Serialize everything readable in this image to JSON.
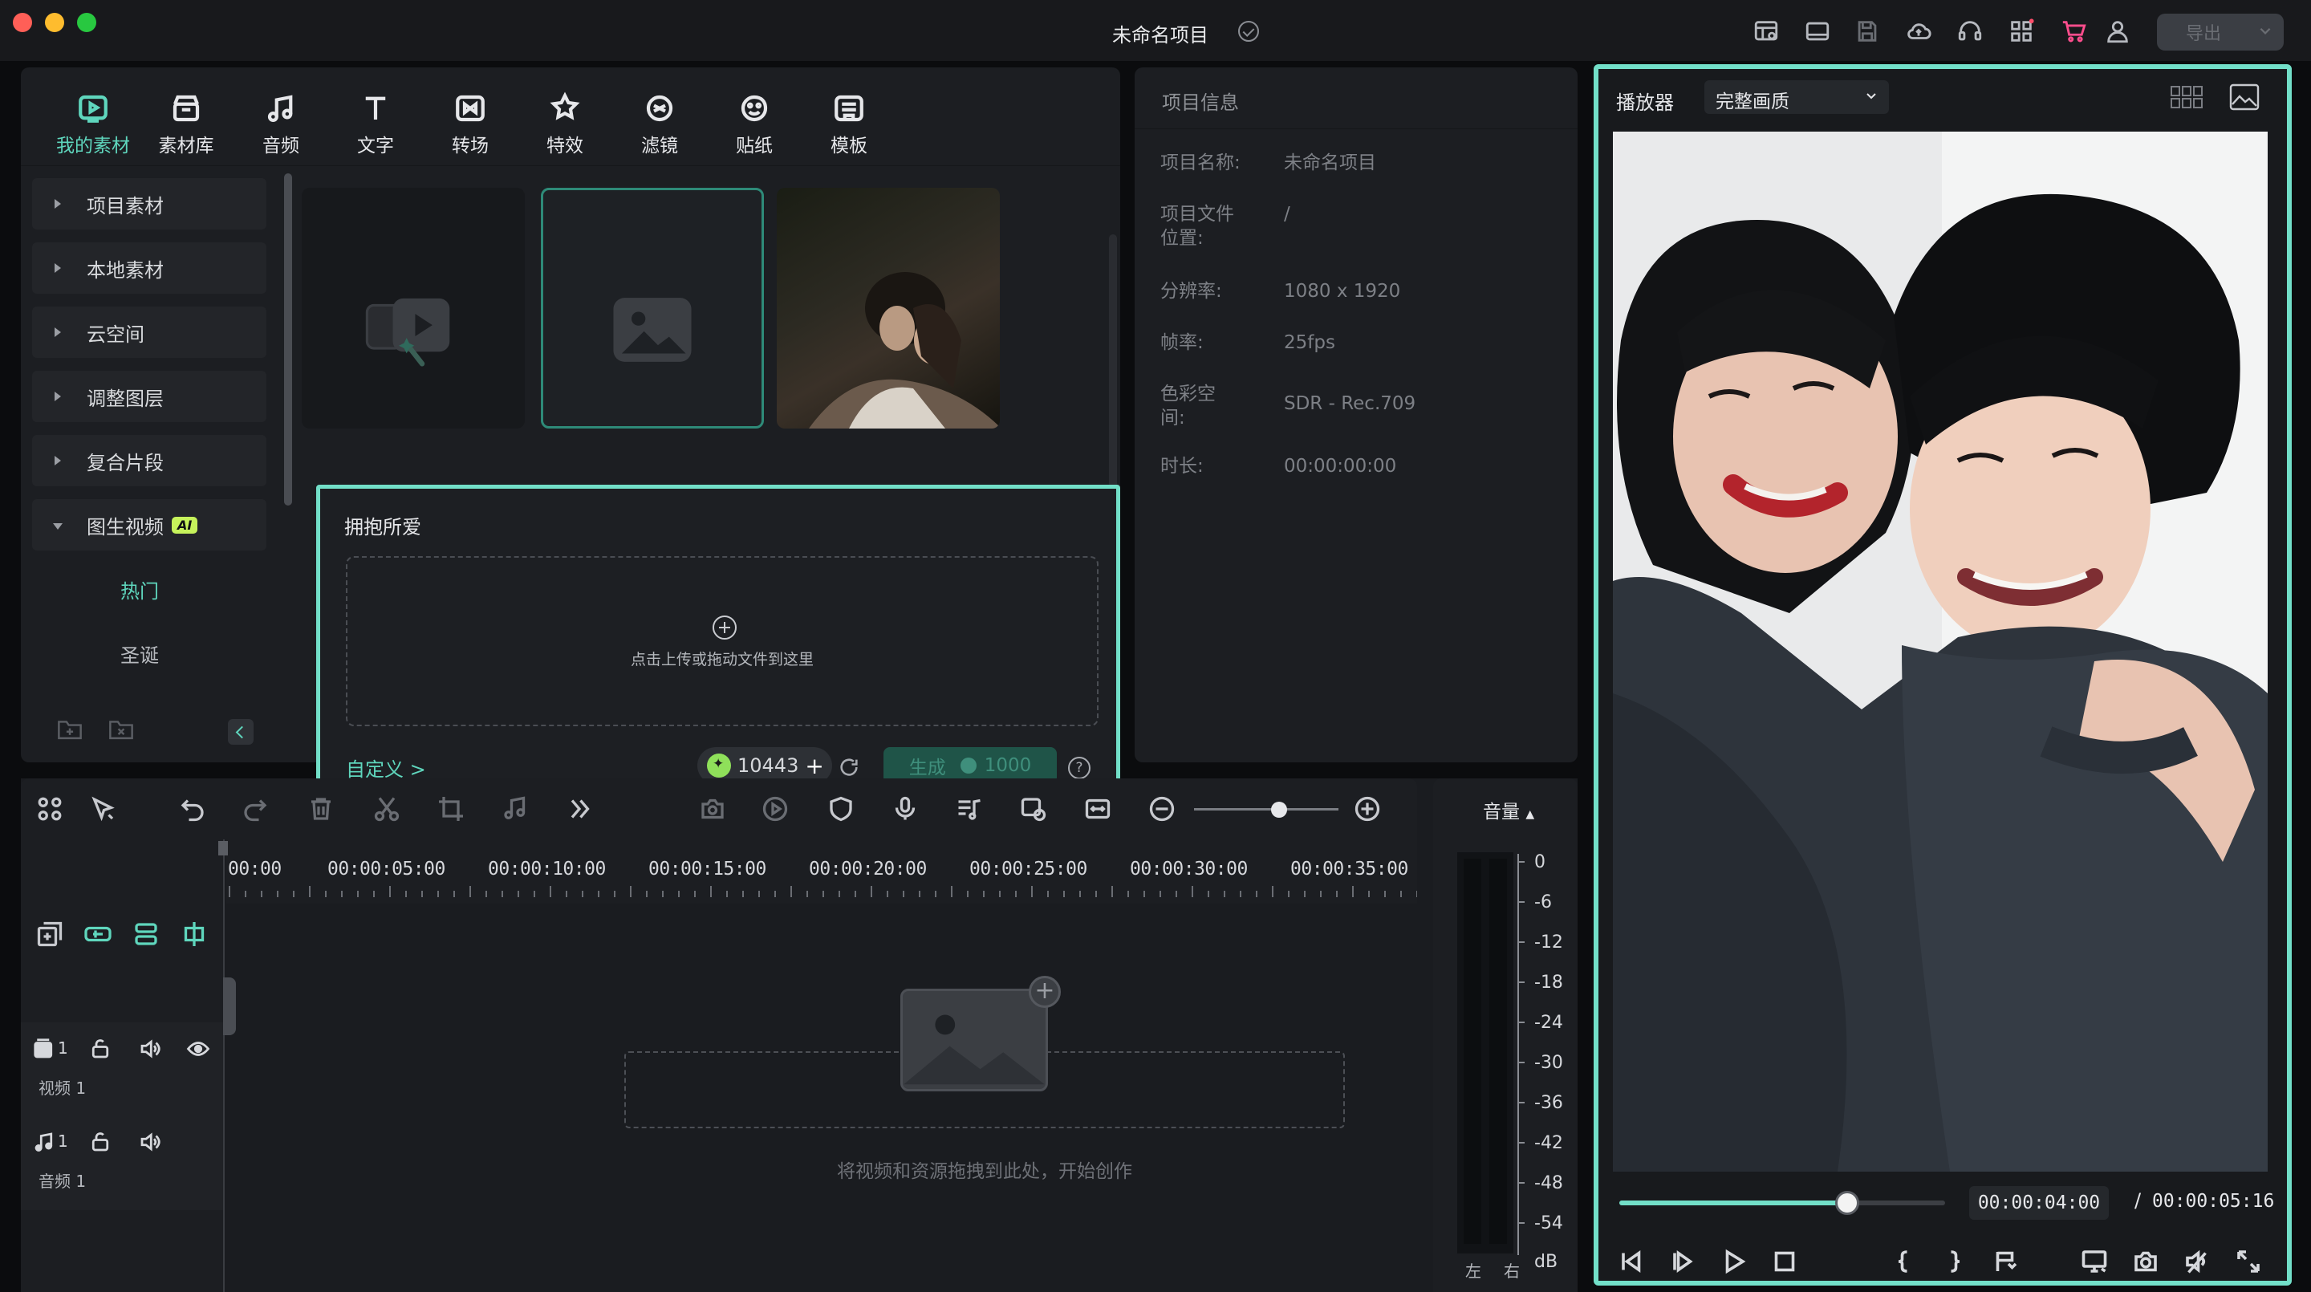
{
  "titlebar": {
    "project_title": "未命名项目",
    "export_label": "导出",
    "icons": [
      "layout-panels-icon",
      "window-icon",
      "save-icon",
      "cloud-icon",
      "headset-icon",
      "apps-icon",
      "cart-icon",
      "user-icon"
    ]
  },
  "media_panel": {
    "tabs": [
      {
        "label": "我的素材",
        "icon": "my-media-icon",
        "active": true
      },
      {
        "label": "素材库",
        "icon": "library-icon"
      },
      {
        "label": "音频",
        "icon": "music-note-icon"
      },
      {
        "label": "文字",
        "icon": "text-icon"
      },
      {
        "label": "转场",
        "icon": "transition-icon"
      },
      {
        "label": "特效",
        "icon": "effects-icon"
      },
      {
        "label": "滤镜",
        "icon": "filter-icon"
      },
      {
        "label": "贴纸",
        "icon": "sticker-icon"
      },
      {
        "label": "模板",
        "icon": "template-icon"
      }
    ],
    "categories": [
      {
        "label": "项目素材"
      },
      {
        "label": "本地素材"
      },
      {
        "label": "云空间"
      },
      {
        "label": "调整图层"
      },
      {
        "label": "复合片段"
      },
      {
        "label": "图生视频",
        "badge": "AI",
        "open": true
      }
    ],
    "sub_categories": [
      {
        "label": "热门",
        "active": true
      },
      {
        "label": "圣诞"
      }
    ]
  },
  "popup": {
    "title": "拥抱所爱",
    "upload_text": "点击上传或拖动文件到这里",
    "custom_link": "自定义 >",
    "credits": "10443",
    "generate_label": "生成",
    "generate_cost": "1000",
    "help": "?"
  },
  "project_info": {
    "title": "项目信息",
    "rows": [
      {
        "key": "项目名称:",
        "value": "未命名项目"
      },
      {
        "key": "项目文件位置:",
        "value": "/"
      },
      {
        "key": "分辨率:",
        "value": "1080 x 1920"
      },
      {
        "key": "帧率:",
        "value": "25fps"
      },
      {
        "key": "色彩空间:",
        "value": "SDR - Rec.709"
      },
      {
        "key": "时长:",
        "value": "00:00:00:00"
      }
    ]
  },
  "player": {
    "label": "播放器",
    "quality": "完整画质",
    "current_time": "00:00:04:00",
    "separator": "/",
    "total_time": "00:00:05:16",
    "progress": 0.7
  },
  "timeline": {
    "ruler": [
      "00:00",
      "00:00:05:00",
      "00:00:10:00",
      "00:00:15:00",
      "00:00:20:00",
      "00:00:25:00",
      "00:00:30:00",
      "00:00:35:00"
    ],
    "tracks": [
      {
        "number": "1",
        "name": "视频 1"
      },
      {
        "number": "1",
        "name": "音频 1"
      }
    ],
    "drop_text": "将视频和资源拖拽到此处，开始创作"
  },
  "volume": {
    "label": "音量",
    "scale": [
      "0",
      "-6",
      "-12",
      "-18",
      "-24",
      "-30",
      "-36",
      "-42",
      "-48",
      "-54"
    ],
    "unit": "dB",
    "left": "左",
    "right": "右"
  },
  "colors": {
    "accent": "#5fd6bd",
    "highlight_border": "#72dfc8",
    "ai_badge": "#c6f35b"
  }
}
